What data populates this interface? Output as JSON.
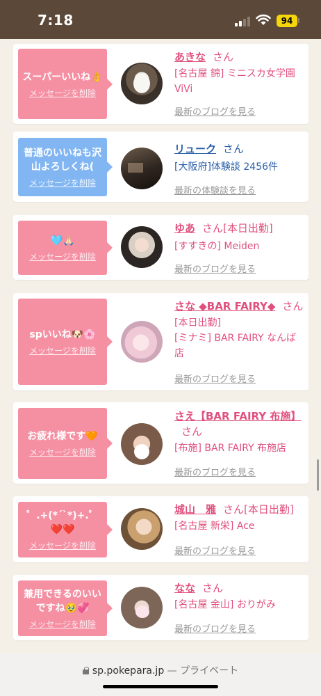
{
  "status": {
    "time": "7:18",
    "battery": "94"
  },
  "cards": [
    {
      "message": "スーパーいいね👌",
      "delete_label": "メッセージを削除",
      "name": "あきな",
      "honorific": "さん",
      "tag": "",
      "details": [
        "[名古屋 錦] ミニスカ女学園ViVi"
      ],
      "link": "最新のブログを見る",
      "bubble_color": "#f590a3"
    },
    {
      "message": "普通のいいねも沢山よろしくね(",
      "delete_label": "メッセージを削除",
      "name": "リューク",
      "honorific": "さん",
      "tag": "",
      "details": [
        "[大阪府]体験談 2456件"
      ],
      "link": "最新の体験談を見る",
      "bubble_color": "#82b6f2"
    },
    {
      "message": "🩵🙏🏻",
      "delete_label": "メッセージを削除",
      "name": "ゆあ",
      "honorific": "さん",
      "tag": "[本日出勤]",
      "details": [
        "[すすきの] Meiden"
      ],
      "link": "最新のブログを見る",
      "bubble_color": "#f590a3"
    },
    {
      "message": "spいいね🐶🌸",
      "delete_label": "メッセージを削除",
      "name": "さな ◆BAR FAIRY◆",
      "honorific": "さん",
      "tag": "",
      "details": [
        "[本日出勤]",
        "[ミナミ] BAR FAIRY なんば店"
      ],
      "link": "最新のブログを見る",
      "bubble_color": "#f590a3"
    },
    {
      "message": "お疲れ様です🧡",
      "delete_label": "メッセージを削除",
      "name": "さえ【BAR FAIRY 布施】",
      "honorific": "さん",
      "tag": "",
      "details": [
        "[布施] BAR FAIRY 布施店"
      ],
      "link": "最新のブログを見る",
      "bubble_color": "#f590a3"
    },
    {
      "message": "゜.+(*´`*)+.゜❤️❤️",
      "delete_label": "メッセージを削除",
      "name": "城山　雅",
      "honorific": "さん",
      "tag": "[本日出勤]",
      "details": [
        "[名古屋 新栄] Ace"
      ],
      "link": "最新のブログを見る",
      "bubble_color": "#f590a3"
    },
    {
      "message": "兼用できるのいいですね🥹💞",
      "delete_label": "メッセージを削除",
      "name": "なな",
      "honorific": "さん",
      "tag": "",
      "details": [
        "[名古屋 金山] おりがみ"
      ],
      "link": "最新のブログを見る",
      "bubble_color": "#f590a3"
    }
  ],
  "url_bar": {
    "domain": "sp.pokepara.jp",
    "suffix": " — プライベート"
  }
}
